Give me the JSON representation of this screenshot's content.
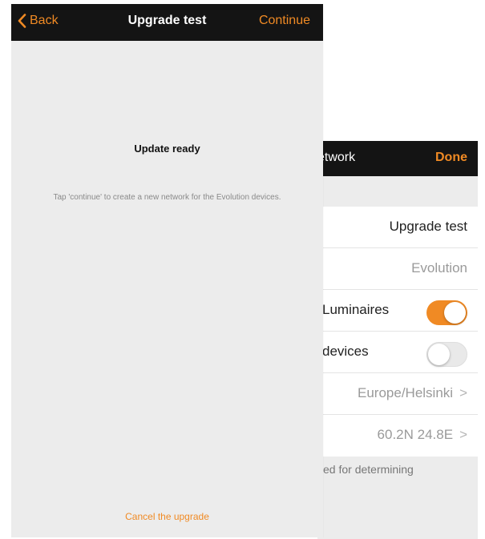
{
  "back_screen": {
    "nav": {
      "title_partial": "etwork",
      "done_label": "Done"
    },
    "rows": [
      {
        "value": "Upgrade test"
      },
      {
        "value": "Evolution"
      },
      {
        "label": "Luminaires",
        "toggle": "on"
      },
      {
        "label": "devices",
        "toggle": "off"
      },
      {
        "value": "Europe/Helsinki",
        "chevron": ">"
      },
      {
        "value": "60.2N 24.8E",
        "chevron": ">"
      }
    ],
    "footnote": "sed for determining"
  },
  "front_screen": {
    "nav": {
      "back_label": "Back",
      "title": "Upgrade test",
      "continue_label": "Continue"
    },
    "update_title": "Update ready",
    "update_description": "Tap 'continue' to create a new network for the Evolution devices.",
    "cancel_label": "Cancel the upgrade"
  },
  "colors": {
    "accent": "#f08a24",
    "nav_background": "#141414",
    "screen_background": "#ececec"
  }
}
